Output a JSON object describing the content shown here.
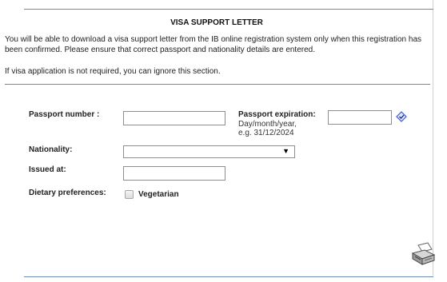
{
  "section": {
    "title": "VISA SUPPORT LETTER",
    "intro": "You will be able to download a visa support letter from the IB online registration system only when this registration has been confirmed. Please ensure that correct passport and nationality details are entered.",
    "note": "If visa application is not required, you can ignore this section."
  },
  "form": {
    "passport_number_label": "Passport number :",
    "passport_number_value": "",
    "passport_expiration_label": "Passport expiration:",
    "passport_expiration_hint_1": "Day/month/year,",
    "passport_expiration_hint_2": "e.g. 31/12/2024",
    "passport_expiration_value": "",
    "nationality_label": "Nationality:",
    "nationality_selected": "",
    "issued_at_label": "Issued at:",
    "issued_at_value": "",
    "dietary_label": "Dietary preferences:",
    "vegetarian_label": "Vegetarian",
    "vegetarian_checked": false
  },
  "icons": {
    "calendar": "calendar-icon",
    "print": "printer-icon"
  },
  "colors": {
    "rule": "#6c8ab0",
    "calendar_accent": "#3a5fd0"
  }
}
